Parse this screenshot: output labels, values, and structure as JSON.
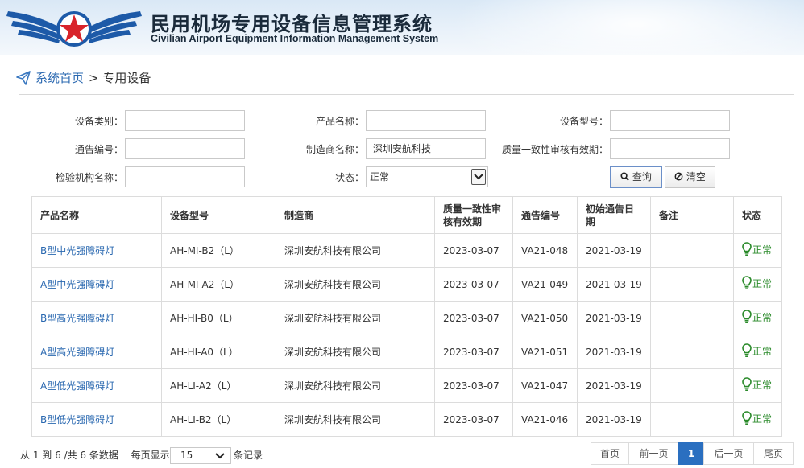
{
  "header": {
    "title_cn": "民用机场专用设备信息管理系统",
    "title_en": "Civilian Airport Equipment Information Management System",
    "logo_colors": {
      "wing": "#1d5aa8",
      "star": "#d8232a"
    }
  },
  "breadcrumb": {
    "home": "系统首页",
    "current": "> 专用设备"
  },
  "form": {
    "category_label": "设备类别：",
    "category_value": "",
    "product_label": "产品名称：",
    "product_value": "",
    "model_label": "设备型号：",
    "model_value": "",
    "notice_label": "通告编号：",
    "notice_value": "",
    "maker_label": "制造商名称：",
    "maker_value": "深圳安航科技",
    "quality_label": "质量一致性审核有效期：",
    "quality_value": "",
    "agency_label": "检验机构名称：",
    "agency_value": "",
    "status_label": "状态：",
    "status_value": "正常",
    "search_label": "查询",
    "clear_label": "清空"
  },
  "table": {
    "headers": [
      "产品名称",
      "设备型号",
      "制造商",
      "质量一致性审核有效期",
      "通告编号",
      "初始通告日期",
      "备注",
      "状态"
    ],
    "rows": [
      [
        "B型中光强障碍灯",
        "AH-MI-B2（L）",
        "深圳安航科技有限公司",
        "2023-03-07",
        "VA21-048",
        "2021-03-19",
        "",
        "正常"
      ],
      [
        "A型中光强障碍灯",
        "AH-MI-A2（L）",
        "深圳安航科技有限公司",
        "2023-03-07",
        "VA21-049",
        "2021-03-19",
        "",
        "正常"
      ],
      [
        "B型高光强障碍灯",
        "AH-HI-B0（L）",
        "深圳安航科技有限公司",
        "2023-03-07",
        "VA21-050",
        "2021-03-19",
        "",
        "正常"
      ],
      [
        "A型高光强障碍灯",
        "AH-HI-A0（L）",
        "深圳安航科技有限公司",
        "2023-03-07",
        "VA21-051",
        "2021-03-19",
        "",
        "正常"
      ],
      [
        "A型低光强障碍灯",
        "AH-LI-A2（L）",
        "深圳安航科技有限公司",
        "2023-03-07",
        "VA21-047",
        "2021-03-19",
        "",
        "正常"
      ],
      [
        "B型低光强障碍灯",
        "AH-LI-B2（L）",
        "深圳安航科技有限公司",
        "2023-03-07",
        "VA21-046",
        "2021-03-19",
        "",
        "正常"
      ]
    ]
  },
  "footer": {
    "info": "从 1 到 6 /共 6 条数据",
    "per_page_label": "每页显示",
    "per_page_value": "15",
    "records_label": "条记录",
    "first": "首页",
    "prev": "前一页",
    "page": "1",
    "next": "后一页",
    "last": "尾页"
  }
}
